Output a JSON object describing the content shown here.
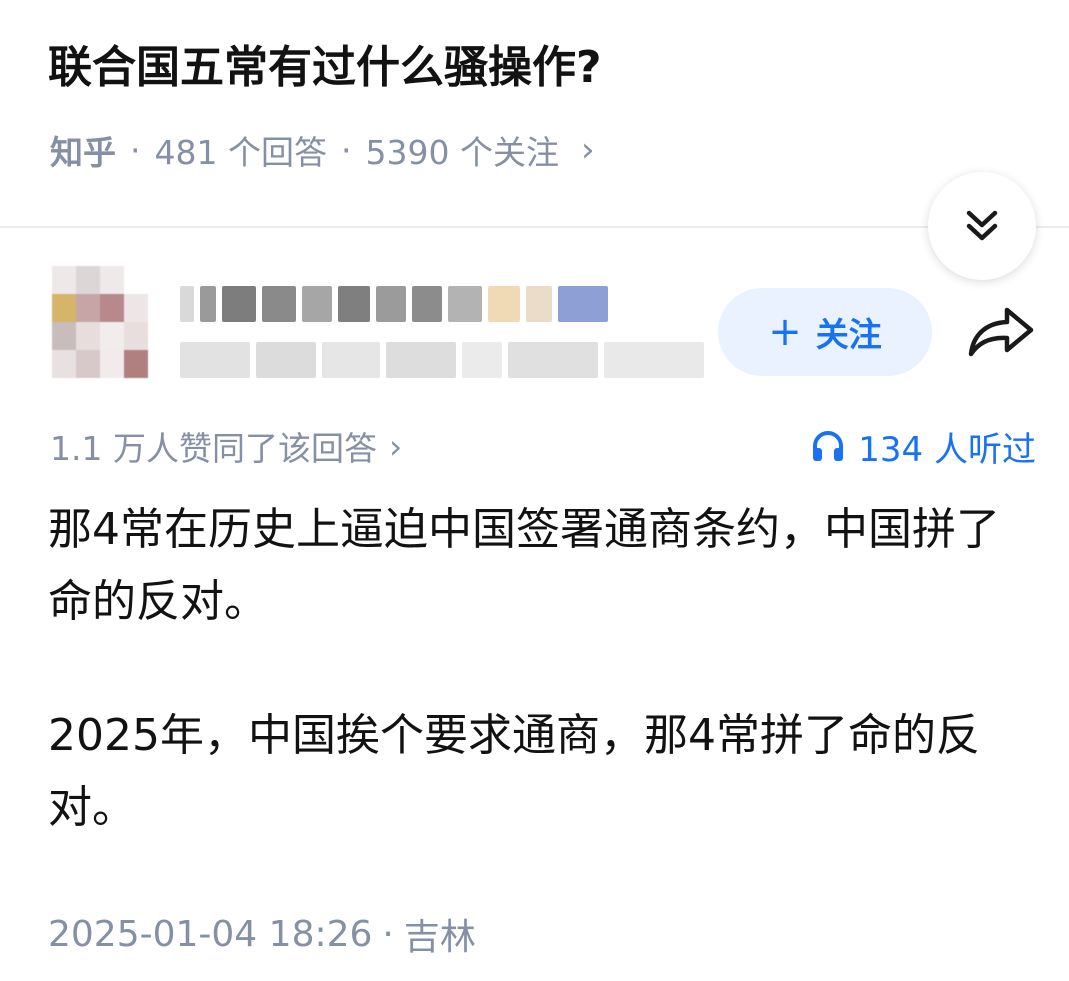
{
  "question": {
    "title": "联合国五常有过什么骚操作?",
    "source": "知乎",
    "separator": "·",
    "answers": "481 个回答",
    "followers": "5390 个关注",
    "chevron": "›"
  },
  "toolbar": {
    "collapse_icon": "double-chevron-down-icon"
  },
  "author": {
    "follow_label": "关注",
    "follow_plus": "+",
    "share_icon": "share-arrow-icon"
  },
  "answer": {
    "approvals": "1.1 万人赞同了该回答",
    "approvals_chevron": "›",
    "listeners": "134 人听过",
    "listen_icon": "headphones-icon",
    "paragraphs": [
      "那4常在历史上逼迫中国签署通商条约，中国拼了命的反对。",
      "2025年，中国挨个要求通商，那4常拼了命的反对。"
    ],
    "timestamp": "2025-01-04 18:26",
    "location_separator": "·",
    "location": "吉林"
  },
  "colors": {
    "accent": "#1772f6",
    "muted": "#8590a6",
    "follow_bg": "#eaf2ff",
    "text": "#121212"
  }
}
